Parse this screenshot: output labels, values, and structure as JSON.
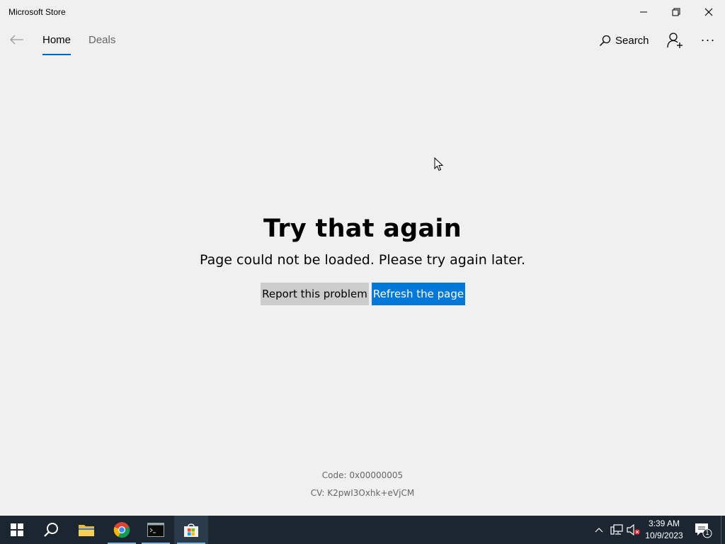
{
  "window": {
    "title": "Microsoft Store",
    "minimize_icon": "minimize-icon",
    "restore_icon": "restore-icon",
    "close_icon": "close-icon"
  },
  "nav": {
    "back_icon": "back-arrow-icon",
    "tabs": [
      {
        "label": "Home",
        "selected": true
      },
      {
        "label": "Deals",
        "selected": false
      }
    ],
    "search_label": "Search",
    "account_icon": "add-user-icon",
    "more_label": "···"
  },
  "error": {
    "title": "Try that again",
    "message": "Page could not be loaded. Please try again later.",
    "report_label": "Report this problem",
    "refresh_label": "Refresh the page",
    "code": "Code: 0x00000005",
    "cv": "CV: K2pwI3Oxhk+eVjCM"
  },
  "taskbar": {
    "items": [
      {
        "name": "start",
        "icon": "windows-icon"
      },
      {
        "name": "search",
        "icon": "search-icon"
      },
      {
        "name": "file-explorer",
        "icon": "folder-icon"
      },
      {
        "name": "chrome",
        "icon": "chrome-icon"
      },
      {
        "name": "terminal",
        "icon": "terminal-icon"
      },
      {
        "name": "store",
        "icon": "store-icon",
        "active": true
      }
    ],
    "tray": {
      "time": "3:39 AM",
      "date": "10/9/2023",
      "notification_count": "1"
    }
  },
  "colors": {
    "accent": "#0078d7",
    "tab_underline": "#0067c0",
    "taskbar": "#1b2631",
    "background": "#f0f0f0"
  }
}
